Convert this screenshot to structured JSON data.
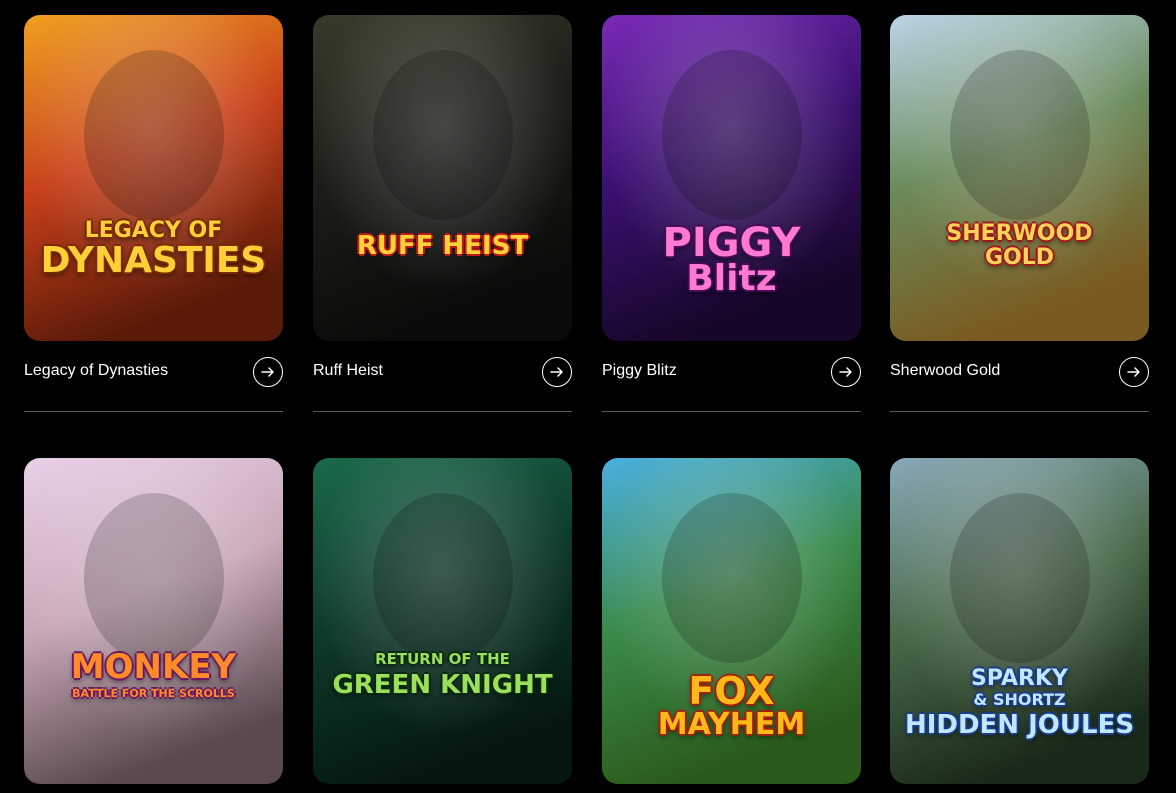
{
  "games": [
    {
      "title": "Legacy of Dynasties",
      "logo_lines": [
        "LEGACY OF",
        "DYNASTIES"
      ],
      "colors": [
        "#f0a020",
        "#c8401a",
        "#5a1a08"
      ],
      "logo_color": "#ffcf3a",
      "logo_stroke": "#7a2a00"
    },
    {
      "title": "Ruff Heist",
      "logo_lines": [
        "RUFF HEIST"
      ],
      "colors": [
        "#3a3a2a",
        "#1c1c18",
        "#0a0a08"
      ],
      "logo_color": "#ffd23a",
      "logo_stroke": "#c01818"
    },
    {
      "title": "Piggy Blitz",
      "logo_lines": [
        "PIGGY",
        "Blitz"
      ],
      "colors": [
        "#7a2ab8",
        "#3a1070",
        "#160628"
      ],
      "logo_color": "#ff7ad0",
      "logo_stroke": "#4a0a5a"
    },
    {
      "title": "Sherwood Gold",
      "logo_lines": [
        "SHERWOOD",
        "GOLD"
      ],
      "colors": [
        "#bcd4e8",
        "#6a8a5a",
        "#7a5a20"
      ],
      "logo_color": "#ffd25a",
      "logo_stroke": "#a01818"
    },
    {
      "title": "",
      "logo_lines": [
        "MONKEY",
        "BATTLE FOR THE SCROLLS"
      ],
      "colors": [
        "#e8d0e8",
        "#c8a8b8",
        "#5a4a50"
      ],
      "logo_color": "#ff8a2a",
      "logo_stroke": "#6a1a60"
    },
    {
      "title": "",
      "logo_lines": [
        "RETURN OF THE",
        "GREEN KNIGHT"
      ],
      "colors": [
        "#1a6a4a",
        "#0e3a2a",
        "#051810"
      ],
      "logo_color": "#9ae05a",
      "logo_stroke": "#0a2a10"
    },
    {
      "title": "",
      "logo_lines": [
        "FOX",
        "MAYHEM"
      ],
      "colors": [
        "#4ab0e0",
        "#3a8a4a",
        "#2a5a1a"
      ],
      "logo_color": "#ffb81a",
      "logo_stroke": "#a0200a"
    },
    {
      "title": "",
      "logo_lines": [
        "SPARKY",
        "& SHORTZ",
        "HIDDEN JOULES"
      ],
      "colors": [
        "#8aa8b8",
        "#4a6a4a",
        "#1a2a1a"
      ],
      "logo_color": "#bfe8ff",
      "logo_stroke": "#1a3a8a"
    }
  ]
}
